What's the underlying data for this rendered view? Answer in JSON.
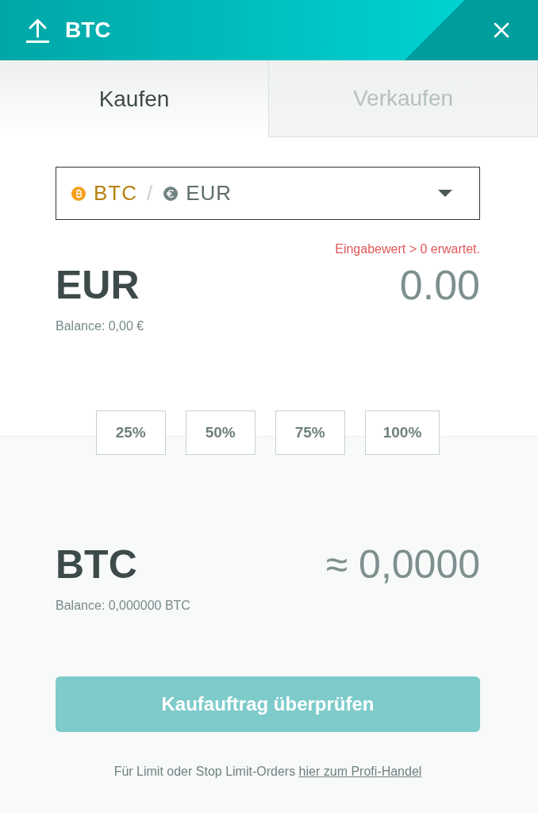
{
  "header": {
    "title": "BTC"
  },
  "tabs": [
    {
      "label": "Kaufen",
      "selected": true
    },
    {
      "label": "Verkaufen",
      "selected": false
    }
  ],
  "pair_select": {
    "base": "BTC",
    "separator": "/",
    "quote": "EUR"
  },
  "pay": {
    "currency": "EUR",
    "error": "Eingabewert > 0 erwartet.",
    "amount": "0.00",
    "balance": "Balance: 0,00 €"
  },
  "percent_buttons": [
    "25%",
    "50%",
    "75%",
    "100%"
  ],
  "receive": {
    "currency": "BTC",
    "amount": "≈ 0,0000",
    "balance": "Balance: 0,000000 BTC"
  },
  "submit_button": {
    "label": "Kaufauftrag überprüfen",
    "disabled": true
  },
  "footer": {
    "text": "Für Limit oder Stop Limit-Orders",
    "link": "hier zum Profi-Handel"
  }
}
